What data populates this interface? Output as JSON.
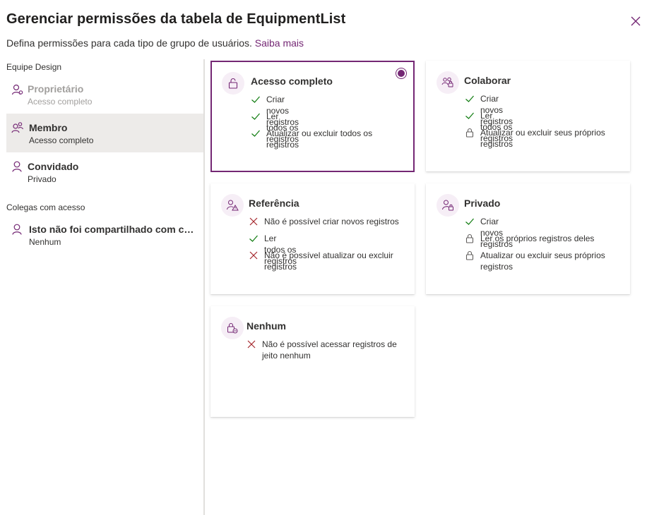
{
  "header": {
    "title": "Gerenciar permissões da tabela de EquipmentList",
    "subtitle": "Defina permissões para cada tipo de grupo de usuários.",
    "learn_more": "Saiba mais"
  },
  "icons": {
    "close": "close-icon",
    "check": "checkmark-icon",
    "cross": "x-icon",
    "lock": "lock-icon"
  },
  "colors": {
    "accent": "#742774",
    "check": "#107c10",
    "cross": "#a4262c",
    "selected_row": "#edebe9",
    "icon_bg": "#f6eef6"
  },
  "sidebar": {
    "team_label": "Equipe Design",
    "roles": [
      {
        "name": "Proprietário",
        "access": "Acesso completo",
        "icon": "owner-icon"
      },
      {
        "name": "Membro",
        "access": "Acesso completo",
        "icon": "member-icon"
      },
      {
        "name": "Convidado",
        "access": "Privado",
        "icon": "guest-icon"
      }
    ],
    "colleagues_label": "Colegas com acesso",
    "colleague": {
      "name": "Isto não foi compartilhado com colegas",
      "access": "Nenhum",
      "icon": "person-icon"
    }
  },
  "cards": [
    {
      "title": "Acesso completo",
      "icon": "lock-open-icon",
      "selected": true,
      "perms": [
        {
          "type": "check",
          "text": "Criar novos registros"
        },
        {
          "type": "check",
          "text": "Ler todos os registros"
        },
        {
          "type": "check",
          "text": "Atualizar ou excluir todos os",
          "text2": "registros"
        }
      ]
    },
    {
      "title": "Colaborar",
      "icon": "people-icon",
      "selected": false,
      "perms": [
        {
          "type": "check",
          "text": "Criar novos registros"
        },
        {
          "type": "check",
          "text": "Ler todos os registros"
        },
        {
          "type": "lock",
          "text": "Atualizar ou excluir seus próprios",
          "text2": "registros"
        }
      ]
    },
    {
      "title": "Referência",
      "icon": "person-warning-icon",
      "selected": false,
      "perms": [
        {
          "type": "cross",
          "text": "Não é possível criar novos registros"
        },
        {
          "type": "check",
          "text": "Ler todos os registros"
        },
        {
          "type": "cross",
          "text": "Não é possível atualizar ou excluir",
          "text2": "registros"
        }
      ]
    },
    {
      "title": "Privado",
      "icon": "person-lock-icon",
      "selected": false,
      "perms": [
        {
          "type": "check",
          "text": "Criar novos registros"
        },
        {
          "type": "lock",
          "text": "Ler os próprios registros deles"
        },
        {
          "type": "lock",
          "text": "Atualizar ou excluir seus próprios",
          "text2": "registros"
        }
      ]
    },
    {
      "title": "Nenhum",
      "icon": "lock-blocked-icon",
      "selected": false,
      "perms": [
        {
          "type": "cross",
          "text": "Não é possível acessar registros de",
          "text2": "jeito nenhum"
        }
      ]
    }
  ]
}
